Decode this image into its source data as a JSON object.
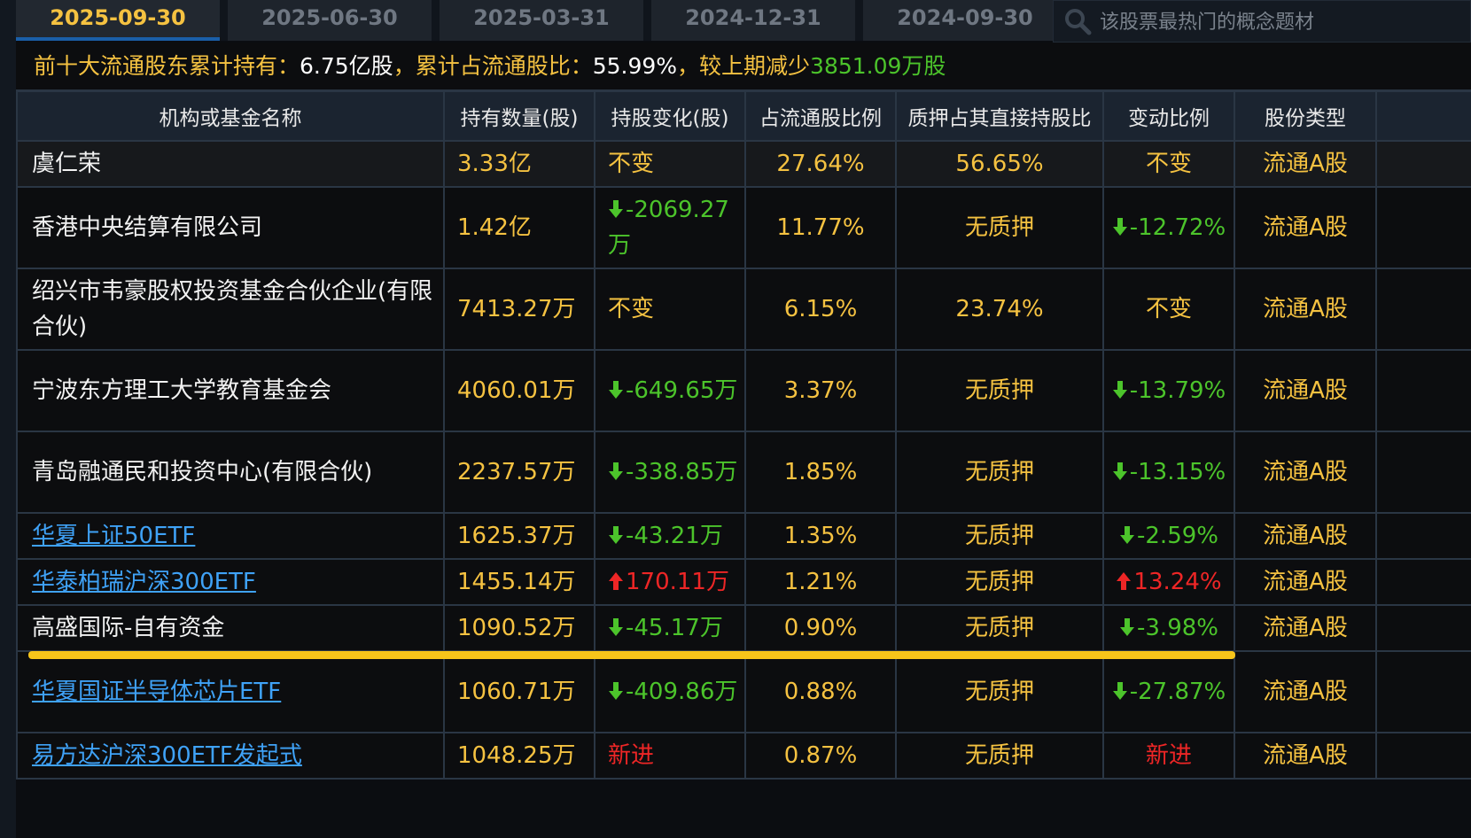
{
  "tabs": [
    "2025-09-30",
    "2025-06-30",
    "2025-03-31",
    "2024-12-31",
    "2024-09-30"
  ],
  "active_tab": 0,
  "search": {
    "placeholder": "该股票最热门的概念题材"
  },
  "summary": {
    "label1": "前十大流通股东累计持有：",
    "value1": "6.75亿股",
    "label2": "，累计占流通股比：",
    "value2": "55.99%",
    "label3": "，较上期减少",
    "value3": "3851.09万股"
  },
  "columns": [
    "机构或基金名称",
    "持有数量(股)",
    "持股变化(股)",
    "占流通股比例",
    "质押占其直接持股比",
    "变动比例",
    "股份类型"
  ],
  "rows": [
    {
      "name": "虞仁荣",
      "link": false,
      "qty": "3.33亿",
      "chg": "不变",
      "chg_dir": "none",
      "ratio": "27.64%",
      "pledge": "56.65%",
      "pct": "不变",
      "pct_dir": "none",
      "type": "流通A股"
    },
    {
      "name": "香港中央结算有限公司",
      "link": false,
      "qty": "1.42亿",
      "chg": "-2069.27万",
      "chg_dir": "down",
      "ratio": "11.77%",
      "pledge": "无质押",
      "pct": "-12.72%",
      "pct_dir": "down",
      "type": "流通A股"
    },
    {
      "name": "绍兴市韦豪股权投资基金合伙企业(有限合伙)",
      "link": false,
      "qty": "7413.27万",
      "chg": "不变",
      "chg_dir": "none",
      "ratio": "6.15%",
      "pledge": "23.74%",
      "pct": "不变",
      "pct_dir": "none",
      "type": "流通A股"
    },
    {
      "name": "宁波东方理工大学教育基金会",
      "link": false,
      "qty": "4060.01万",
      "chg": "-649.65万",
      "chg_dir": "down",
      "ratio": "3.37%",
      "pledge": "无质押",
      "pct": "-13.79%",
      "pct_dir": "down",
      "type": "流通A股"
    },
    {
      "name": "青岛融通民和投资中心(有限合伙)",
      "link": false,
      "qty": "2237.57万",
      "chg": "-338.85万",
      "chg_dir": "down",
      "ratio": "1.85%",
      "pledge": "无质押",
      "pct": "-13.15%",
      "pct_dir": "down",
      "type": "流通A股"
    },
    {
      "name": "华夏上证50ETF",
      "link": true,
      "qty": "1625.37万",
      "chg": "-43.21万",
      "chg_dir": "down",
      "ratio": "1.35%",
      "pledge": "无质押",
      "pct": "-2.59%",
      "pct_dir": "down",
      "type": "流通A股"
    },
    {
      "name": "华泰柏瑞沪深300ETF",
      "link": true,
      "qty": "1455.14万",
      "chg": "170.11万",
      "chg_dir": "up",
      "ratio": "1.21%",
      "pledge": "无质押",
      "pct": "13.24%",
      "pct_dir": "up",
      "type": "流通A股"
    },
    {
      "name": "高盛国际-自有资金",
      "link": false,
      "qty": "1090.52万",
      "chg": "-45.17万",
      "chg_dir": "down",
      "ratio": "0.90%",
      "pledge": "无质押",
      "pct": "-3.98%",
      "pct_dir": "down",
      "type": "流通A股"
    },
    {
      "name": "华夏国证半导体芯片ETF",
      "link": true,
      "qty": "1060.71万",
      "chg": "-409.86万",
      "chg_dir": "down",
      "ratio": "0.88%",
      "pledge": "无质押",
      "pct": "-27.87%",
      "pct_dir": "down",
      "type": "流通A股"
    },
    {
      "name": "易方达沪深300ETF发起式",
      "link": true,
      "qty": "1048.25万",
      "chg": "新进",
      "chg_dir": "new",
      "ratio": "0.87%",
      "pledge": "无质押",
      "pct": "新进",
      "pct_dir": "new",
      "type": "流通A股"
    }
  ],
  "colors": {
    "accent": "#f5c241",
    "down": "#4cc42b",
    "up": "#ee2626",
    "link": "#3fa2f7",
    "highlight": "#f7c51a"
  }
}
